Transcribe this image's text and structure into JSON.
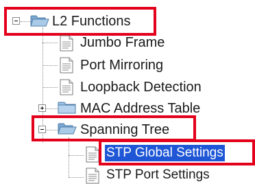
{
  "tree": {
    "root": {
      "label": "L2 Functions",
      "expanded": true
    },
    "items": [
      {
        "label": "Jumbo Frame",
        "icon": "document-icon"
      },
      {
        "label": "Port Mirroring",
        "icon": "document-icon"
      },
      {
        "label": "Loopback Detection",
        "icon": "document-icon"
      },
      {
        "label": "MAC Address Table",
        "icon": "folder-icon",
        "expanded": false
      },
      {
        "label": "Spanning Tree",
        "icon": "folder-open-icon",
        "expanded": true,
        "children": [
          {
            "label": "STP Global Settings",
            "icon": "document-icon",
            "selected": true
          },
          {
            "label": "STP Port Settings",
            "icon": "document-icon"
          }
        ]
      }
    ]
  },
  "colors": {
    "highlight_border": "#e3001b",
    "selection_background": "#1e56d6"
  }
}
